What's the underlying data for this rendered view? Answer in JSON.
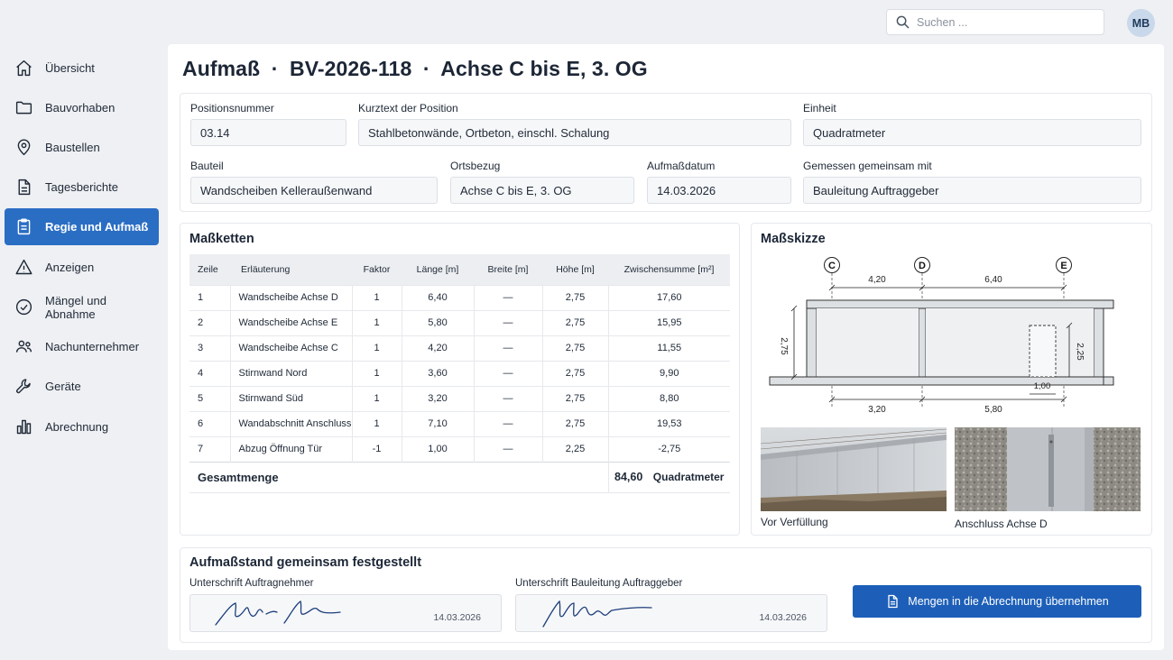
{
  "search": {
    "placeholder": "Suchen ..."
  },
  "user": {
    "initials": "MB"
  },
  "sidebar": {
    "items": [
      {
        "label": "Übersicht",
        "icon": "home-icon"
      },
      {
        "label": "Bauvorhaben",
        "icon": "folder-icon"
      },
      {
        "label": "Baustellen",
        "icon": "map-pin-icon"
      },
      {
        "label": "Tagesberichte",
        "icon": "document-icon"
      },
      {
        "label": "Regie und Aufmaß",
        "icon": "clipboard-icon",
        "active": true
      },
      {
        "label": "Anzeigen",
        "icon": "warning-icon"
      },
      {
        "label": "Mängel und Abnahme",
        "icon": "check-circle-icon"
      },
      {
        "label": "Nachunternehmer",
        "icon": "users-icon"
      },
      {
        "label": "Geräte",
        "icon": "wrench-icon"
      },
      {
        "label": "Abrechnung",
        "icon": "bar-chart-icon"
      }
    ]
  },
  "page": {
    "title_part1": "Aufmaß",
    "title_sep": "·",
    "title_part2": "BV-2026-118",
    "title_part3": "Achse C bis E, 3. OG"
  },
  "fields": {
    "positionsnummer": {
      "label": "Positionsnummer",
      "value": "03.14"
    },
    "kurztext": {
      "label": "Kurztext der Position",
      "value": "Stahlbetonwände, Ortbeton, einschl. Schalung"
    },
    "einheit": {
      "label": "Einheit",
      "value": "Quadratmeter"
    },
    "bauteil": {
      "label": "Bauteil",
      "value": "Wandscheiben Kelleraußenwand"
    },
    "ortsbezug": {
      "label": "Ortsbezug",
      "value": "Achse C bis E, 3. OG"
    },
    "aufmassdatum": {
      "label": "Aufmaßdatum",
      "value": "14.03.2026"
    },
    "gemessen": {
      "label": "Gemessen gemeinsam mit",
      "value": "Bauleitung Auftraggeber"
    }
  },
  "masskette": {
    "title": "Maßketten",
    "headers": [
      "Zeile",
      "Erläuterung",
      "Faktor",
      "Länge [m]",
      "Breite [m]",
      "Höhe [m]",
      "Zwischensumme [m²]"
    ],
    "rows": [
      [
        "1",
        "Wandscheibe Achse D",
        "1",
        "6,40",
        "—",
        "2,75",
        "17,60"
      ],
      [
        "2",
        "Wandscheibe Achse E",
        "1",
        "5,80",
        "—",
        "2,75",
        "15,95"
      ],
      [
        "3",
        "Wandscheibe Achse C",
        "1",
        "4,20",
        "—",
        "2,75",
        "11,55"
      ],
      [
        "4",
        "Stirnwand Nord",
        "1",
        "3,60",
        "—",
        "2,75",
        "9,90"
      ],
      [
        "5",
        "Stirnwand Süd",
        "1",
        "3,20",
        "—",
        "2,75",
        "8,80"
      ],
      [
        "6",
        "Wandabschnitt Anschluss",
        "1",
        "7,10",
        "—",
        "2,75",
        "19,53"
      ],
      [
        "7",
        "Abzug Öffnung Tür",
        "-1",
        "1,00",
        "—",
        "2,25",
        "-2,75"
      ]
    ],
    "total_label": "Gesamtmenge",
    "total_value": "84,60",
    "total_unit": "Quadratmeter"
  },
  "sketch": {
    "title": "Maßskizze",
    "axes": [
      "C",
      "D",
      "E"
    ],
    "dim_top": [
      "4,20",
      "6,40"
    ],
    "dim_bottom": [
      "3,20",
      "5,80"
    ],
    "dim_left": "2,75",
    "dim_right": "2,25",
    "dim_door": "1,00"
  },
  "photos": [
    {
      "caption": "Vor Verfüllung"
    },
    {
      "caption": "Anschluss Achse D"
    }
  ],
  "signatures": {
    "title": "Aufmaßstand gemeinsam festgestellt",
    "contractor": {
      "label": "Unterschrift Auftragnehmer",
      "date": "14.03.2026"
    },
    "client": {
      "label": "Unterschrift Bauleitung Auftraggeber",
      "date": "14.03.2026"
    },
    "submit_label": "Mengen in die Abrechnung übernehmen"
  },
  "colors": {
    "accent": "#2a6ec4",
    "button": "#1d5fb8",
    "background": "#eef0f3"
  }
}
